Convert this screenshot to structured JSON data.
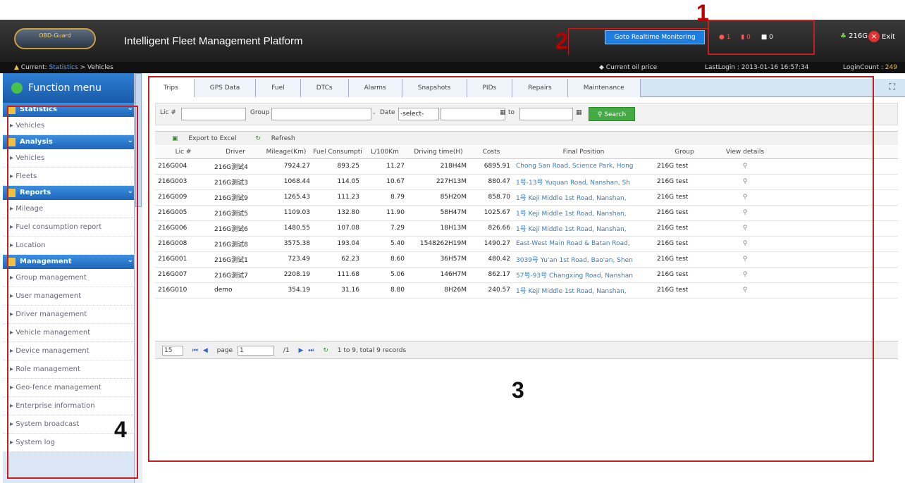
{
  "header": {
    "logo_text": "OBD-Guard",
    "title": "Intelligent Fleet Management Platform",
    "goto_button": "Goto Realtime Monitoring",
    "alarm_badges": [
      "1",
      "0",
      "0"
    ],
    "user": "216G",
    "exit": "Exit"
  },
  "subbar": {
    "crumb_prefix": "Current:",
    "crumb_section": "Statistics",
    "crumb_page": "> Vehicles",
    "oil_price": "Current oil price",
    "last_login": "LastLogin : 2013-01-16 16:57:34",
    "login_count_label": "LoginCount : ",
    "login_count": "249"
  },
  "sidebar": {
    "title": "Function menu",
    "sections": [
      {
        "label": "Statistics",
        "items": [
          "Vehicles"
        ]
      },
      {
        "label": "Analysis",
        "items": [
          "Vehicles",
          "Fleets"
        ]
      },
      {
        "label": "Reports",
        "items": [
          "Mileage",
          "Fuel consumption report",
          "Location"
        ]
      },
      {
        "label": "Management",
        "items": [
          "Group management",
          "User management",
          "Driver management",
          "Vehicle management",
          "Device management",
          "Role management",
          "Geo-fence management",
          "Enterprise information",
          "System broadcast",
          "System log"
        ]
      }
    ]
  },
  "tabs": [
    "Trips",
    "GPS Data",
    "Fuel",
    "DTCs",
    "Alarms",
    "Snapshots",
    "PIDs",
    "Repairs",
    "Maintenance"
  ],
  "filter": {
    "lic_label": "Lic #",
    "group_label": "Group",
    "date_label": "Date",
    "date_select": "-select-",
    "to_label": "to",
    "search": "Search"
  },
  "toolbar": {
    "export": "Export to Excel",
    "refresh": "Refresh"
  },
  "table": {
    "headers": [
      "Lic #",
      "Driver",
      "Mileage(Km)",
      "Fuel Consumpti",
      "L/100Km",
      "Driving time(H)",
      "Costs",
      "Final Position",
      "Group",
      "View details"
    ],
    "rows": [
      [
        "216G004",
        "216G测试4",
        "7924.27",
        "893.25",
        "11.27",
        "218H4M",
        "6895.91",
        "Chong San Road, Science Park, Hong",
        "216G test"
      ],
      [
        "216G003",
        "216G测试3",
        "1068.44",
        "114.05",
        "10.67",
        "227H13M",
        "880.47",
        "1号-13号 Yuquan Road, Nanshan, Sh",
        "216G test"
      ],
      [
        "216G009",
        "216G测试9",
        "1265.43",
        "111.23",
        "8.79",
        "85H20M",
        "858.70",
        "1号 Keji Middle 1st Road, Nanshan,",
        "216G test"
      ],
      [
        "216G005",
        "216G测试5",
        "1109.03",
        "132.80",
        "11.90",
        "58H47M",
        "1025.67",
        "1号 Keji Middle 1st Road, Nanshan,",
        "216G test"
      ],
      [
        "216G006",
        "216G测试6",
        "1480.55",
        "107.08",
        "7.29",
        "18H13M",
        "826.66",
        "1号 Keji Middle 1st Road, Nanshan,",
        "216G test"
      ],
      [
        "216G008",
        "216G测试8",
        "3575.38",
        "193.04",
        "5.40",
        "1548262H19M",
        "1490.27",
        "East-West Main Road & Batan Road,",
        "216G test"
      ],
      [
        "216G001",
        "216G测试1",
        "723.49",
        "62.23",
        "8.60",
        "36H57M",
        "480.42",
        "3039号 Yu'an 1st Road, Bao'an, Shen",
        "216G test"
      ],
      [
        "216G007",
        "216G测试7",
        "2208.19",
        "111.68",
        "5.06",
        "146H7M",
        "862.17",
        "57号-93号 Changxing Road, Nanshan",
        "216G test"
      ],
      [
        "216G010",
        "demo",
        "354.19",
        "31.16",
        "8.80",
        "8H26M",
        "240.57",
        "1号 Keji Middle 1st Road, Nanshan,",
        "216G test"
      ]
    ]
  },
  "pager": {
    "page_size": "15",
    "page_label": "page",
    "page_value": "1",
    "of": "/1",
    "summary": "1 to 9, total 9 records"
  },
  "annotations": [
    "1",
    "2",
    "3",
    "4"
  ]
}
